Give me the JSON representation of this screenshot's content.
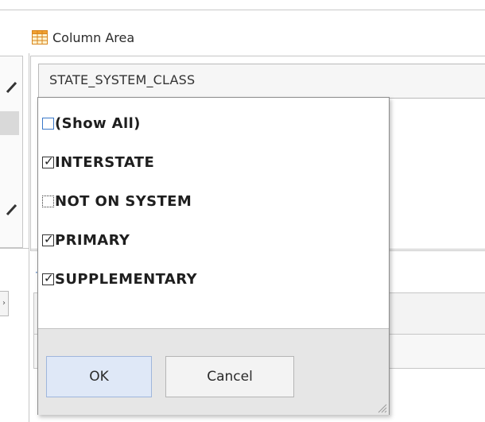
{
  "column_area": {
    "label": "Column Area",
    "icon": "table-icon",
    "field_name": "STATE_SYSTEM_CLASS"
  },
  "filter_popup": {
    "items": [
      {
        "label": "(Show All)",
        "checked": false,
        "focused": false
      },
      {
        "label": "INTERSTATE",
        "checked": true,
        "focused": false
      },
      {
        "label": "NOT ON SYSTEM",
        "checked": false,
        "focused": true
      },
      {
        "label": "PRIMARY",
        "checked": true,
        "focused": false
      },
      {
        "label": "SUPPLEMENTARY",
        "checked": true,
        "focused": false
      }
    ],
    "ok_label": "OK",
    "cancel_label": "Cancel"
  },
  "colors": {
    "accent_ok_bg": "#dfe8f7",
    "accent_ok_border": "#9fb6dc",
    "footer_bg": "#e6e6e6",
    "show_all_checkbox_border": "#3a78c8"
  }
}
